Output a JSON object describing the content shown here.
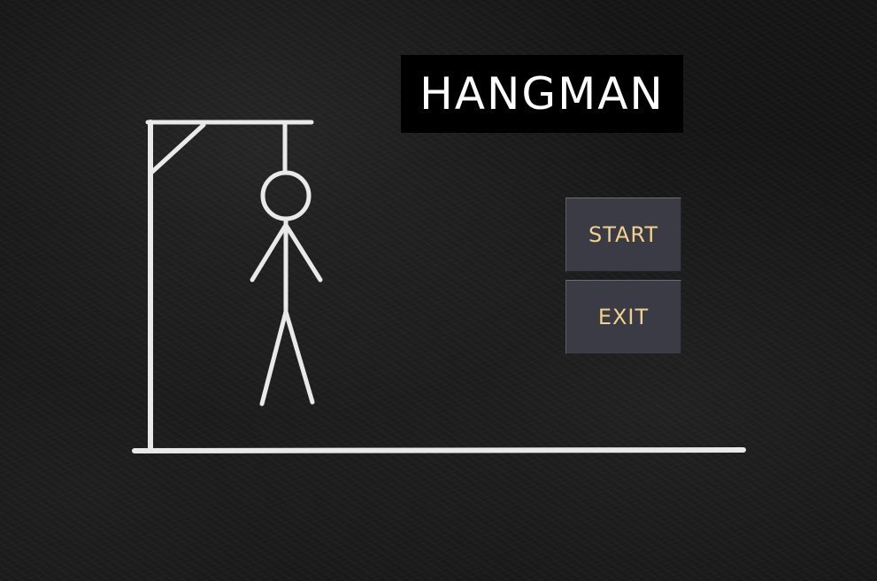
{
  "game": {
    "title": "HANGMAN"
  },
  "menu": {
    "start_label": "START",
    "exit_label": "EXIT"
  },
  "colors": {
    "background": "#151515",
    "chalk": "#e9e9e9",
    "button_bg": "#3a3b44",
    "button_text": "#f2d28a",
    "title_bg": "#000000",
    "title_text": "#ffffff"
  }
}
